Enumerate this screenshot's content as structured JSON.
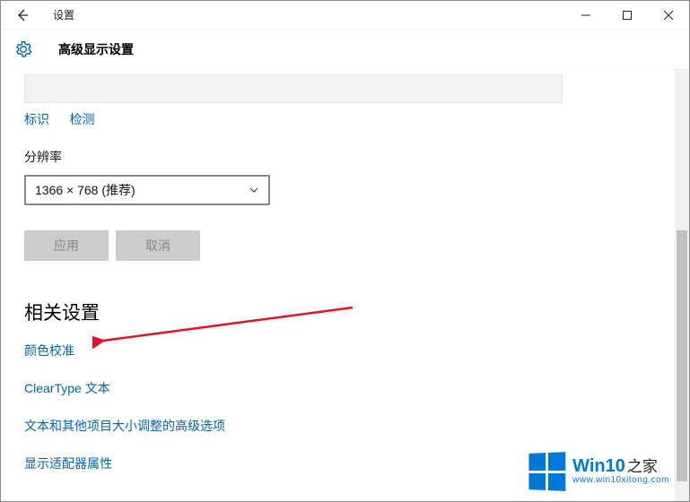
{
  "titlebar": {
    "title": "设置"
  },
  "header": {
    "title": "高级显示设置"
  },
  "links": {
    "identify": "标识",
    "detect": "检测"
  },
  "resolution": {
    "label": "分辨率",
    "selected": "1366 × 768 (推荐)"
  },
  "buttons": {
    "apply": "应用",
    "cancel": "取消"
  },
  "section": {
    "related_heading": "相关设置",
    "color_calibration": "颜色校准",
    "cleartype": "ClearType 文本",
    "advanced_sizing": "文本和其他项目大小调整的高级选项",
    "adapter_props": "显示适配器属性"
  },
  "watermark": {
    "brand_main": "Win10",
    "brand_suffix": "之家",
    "url": "www.win10xitong.com"
  }
}
